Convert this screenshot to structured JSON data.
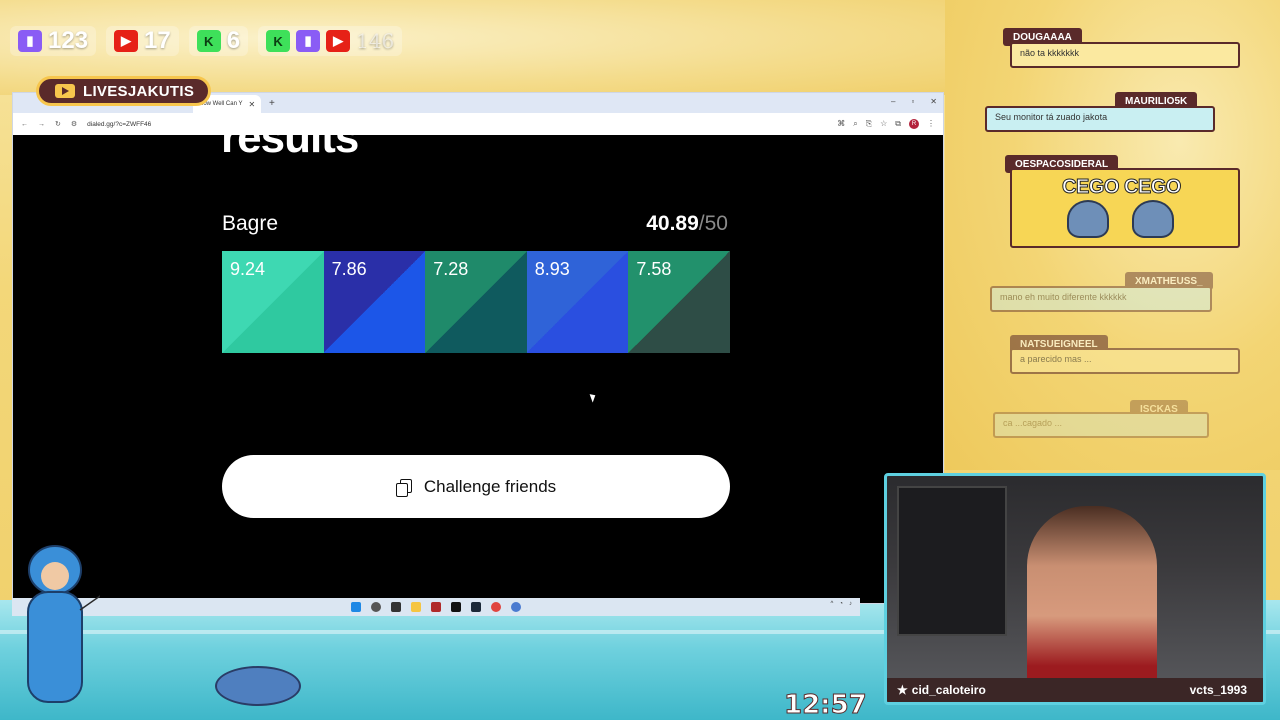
{
  "overlay": {
    "stats": [
      {
        "icon": "twitch-icon",
        "value": "123"
      },
      {
        "icon": "youtube-icon",
        "value": "17"
      },
      {
        "icon": "kick-icon",
        "value": "6"
      },
      {
        "icon": "combined-icon",
        "value": "146"
      }
    ],
    "live_channel": "LIVESJAKUTIS",
    "clock": "12:57"
  },
  "browser": {
    "tab_title": "How Well Can Y",
    "url": "dialed.gg/?c=ZWFF46",
    "new_tab_label": "+",
    "window_controls": [
      "–",
      "▫",
      "✕"
    ]
  },
  "results": {
    "heading": "results",
    "player_name": "Bagre",
    "score": "40.89",
    "score_max": "/50",
    "tiles": [
      {
        "value": "9.24"
      },
      {
        "value": "7.86"
      },
      {
        "value": "7.28"
      },
      {
        "value": "8.93"
      },
      {
        "value": "7.58"
      }
    ],
    "challenge_label": "Challenge friends"
  },
  "chat": [
    {
      "user": "DOUGAAAA",
      "text": "não ta kkkkkkk"
    },
    {
      "user": "MAURILIO5K",
      "text": "Seu monitor tá zuado jakota"
    },
    {
      "user": "OESPACOSIDERAL",
      "text": "CEGO CEGO"
    },
    {
      "user": "XMATHEUSS_",
      "text": "mano eh muito diferente kkkkkk"
    },
    {
      "user": "NATSUEIGNEEL",
      "text": "a parecido mas ..."
    },
    {
      "user": "ISCKAS",
      "text": "ca ...cagado ..."
    }
  ],
  "webcam": {
    "left_name": "cid_caloteiro",
    "right_name": "vcts_1993"
  },
  "colors": {
    "tile1": "#3ed8b2",
    "tile2": "#1c56e8",
    "tile3": "#0f5a5e",
    "tile4": "#2a4fe0",
    "tile5": "#2e4d46",
    "chat_tag": "#5a2a2a"
  }
}
